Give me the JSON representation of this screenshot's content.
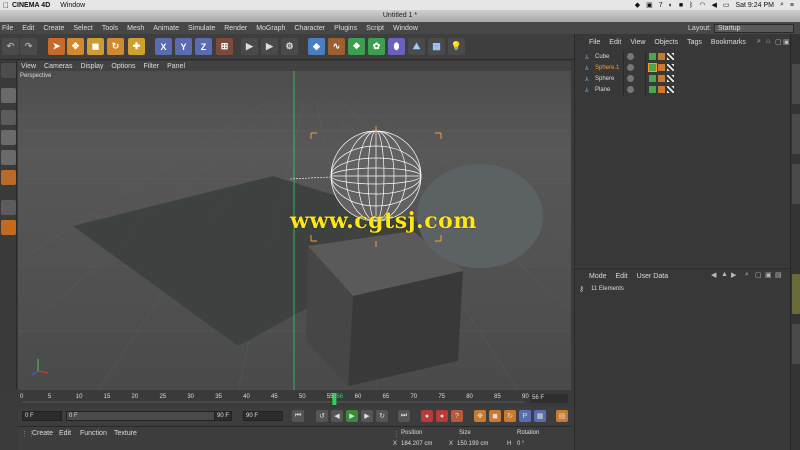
{
  "mac_menubar": {
    "app_name": "CINEMA 4D",
    "items": [
      "Window"
    ],
    "status_time": "Sat 9:24 PM",
    "status_num": "7"
  },
  "window": {
    "title": "Untitled 1 *"
  },
  "c4d_menu": {
    "items": [
      "File",
      "Edit",
      "Create",
      "Select",
      "Tools",
      "Mesh",
      "Animate",
      "Simulate",
      "Render",
      "MoGraph",
      "Character",
      "Plugins",
      "Script",
      "Window"
    ],
    "layout_label": "Layout:",
    "layout_value": "Startup"
  },
  "toolbar": {
    "x_label": "X",
    "y_label": "Y",
    "z_label": "Z"
  },
  "viewport": {
    "menu": [
      "View",
      "Cameras",
      "Display",
      "Options",
      "Filter",
      "Panel"
    ],
    "label": "Perspective",
    "watermark": "www.cgtsj.com"
  },
  "timeline": {
    "ticks": [
      "0",
      "5",
      "10",
      "15",
      "20",
      "25",
      "30",
      "35",
      "40",
      "45",
      "50",
      "55",
      "56",
      "60",
      "65",
      "70",
      "75",
      "80",
      "85",
      "90"
    ],
    "current_frame": "56 F",
    "current_frame_num": 56
  },
  "transport": {
    "start_field": "0 F",
    "min_field": "0 F",
    "max_field": "90 F",
    "end_field": "90 F"
  },
  "material_panel": {
    "menu": [
      "Create",
      "Edit",
      "Function",
      "Texture"
    ]
  },
  "coord_panel": {
    "headers": [
      "Position",
      "Size",
      "Rotation"
    ],
    "x_label": "X",
    "pos_x": "184.207 cm",
    "size_x": "150.199 cm",
    "rot_label": "H",
    "rot_h": "0 °"
  },
  "object_manager": {
    "menu": [
      "File",
      "Edit",
      "View",
      "Objects",
      "Tags",
      "Bookmarks"
    ],
    "objects": [
      {
        "name": "Cube",
        "selected": false
      },
      {
        "name": "Sphere.1",
        "selected": true
      },
      {
        "name": "Sphere",
        "selected": false
      },
      {
        "name": "Plane",
        "selected": false
      }
    ]
  },
  "attribute_manager": {
    "menu": [
      "Mode",
      "Edit",
      "User Data"
    ],
    "elements_label": "11 Elements"
  },
  "colors": {
    "accent_orange": "#ff9a30",
    "watermark": "#ffe617",
    "axis_green": "#2fd35a",
    "axis_blue": "#3a6bd6"
  }
}
